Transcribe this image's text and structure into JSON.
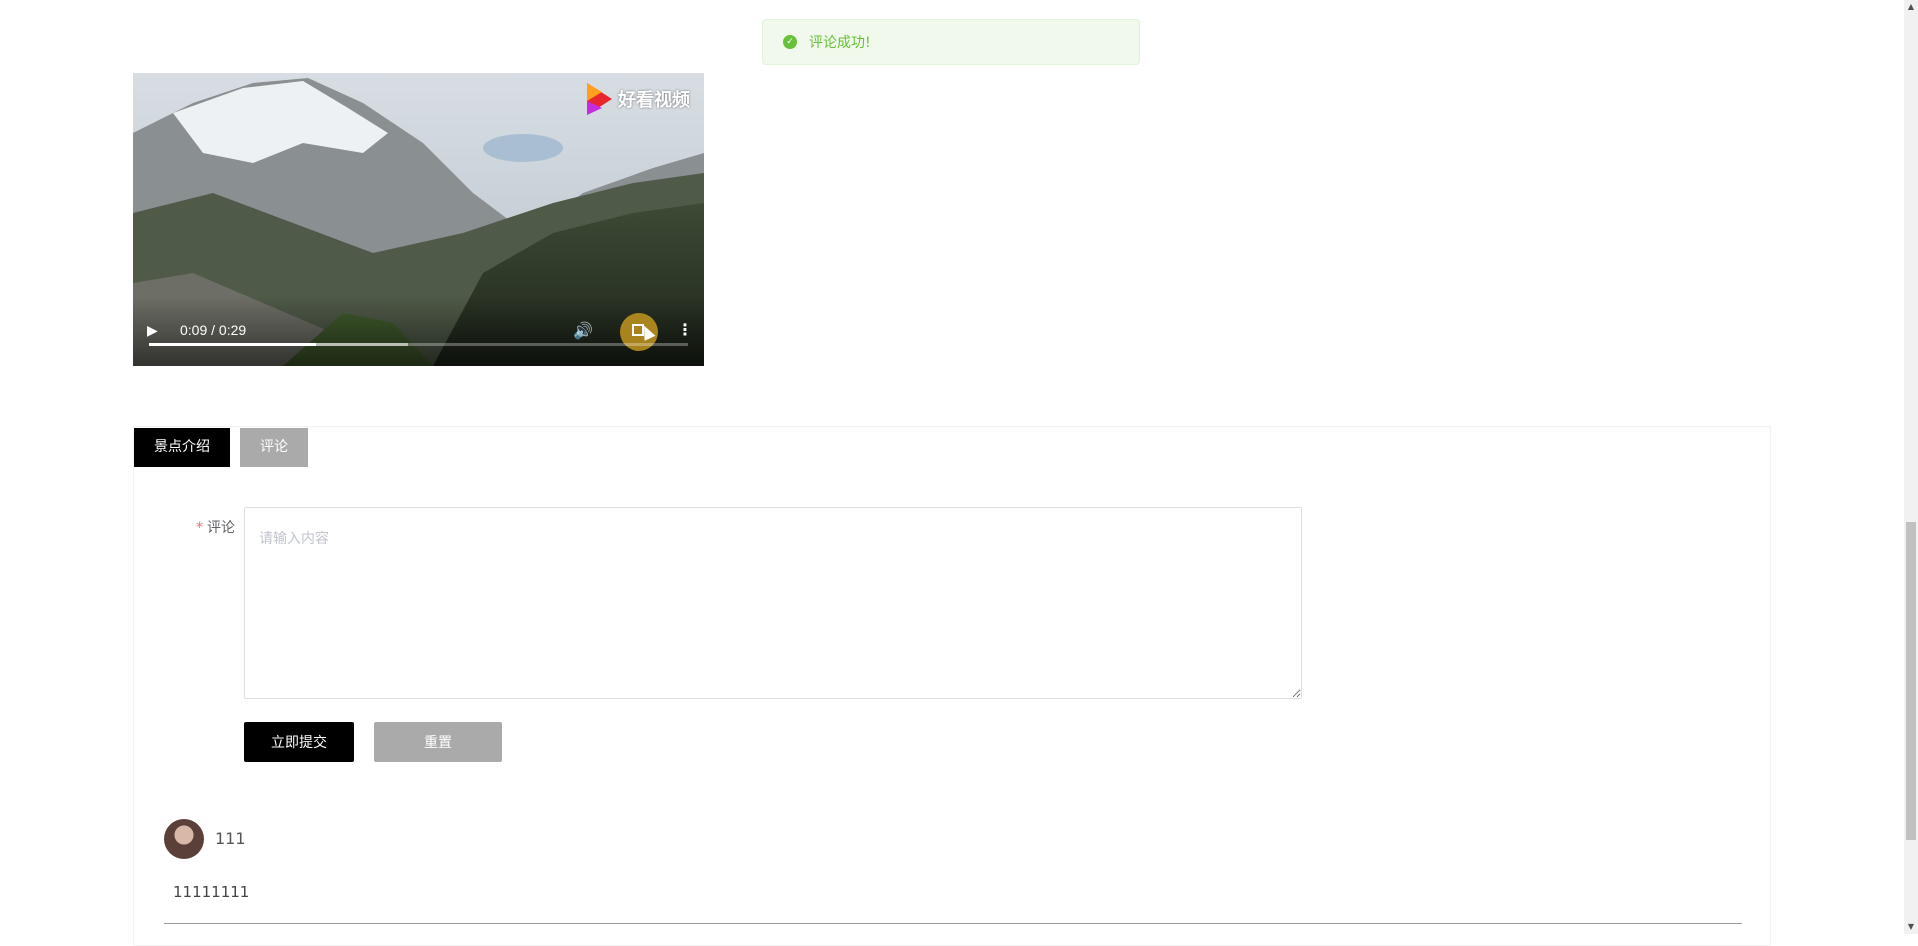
{
  "toast": {
    "text": "评论成功!",
    "icon": "check-circle-icon",
    "color": "#67c23a"
  },
  "video": {
    "watermark": "好看视频",
    "time_display": "0:09 / 0:29",
    "progress_played_fraction": 0.31,
    "progress_buffered_fraction": 0.48
  },
  "tabs": [
    {
      "label": "景点介绍",
      "active": true
    },
    {
      "label": "评论",
      "active": false
    }
  ],
  "form": {
    "required_mark": "*",
    "label": "评论",
    "placeholder": "请输入内容",
    "submit_label": "立即提交",
    "reset_label": "重置"
  },
  "comments": [
    {
      "username": "111",
      "content": "11111111"
    }
  ]
}
